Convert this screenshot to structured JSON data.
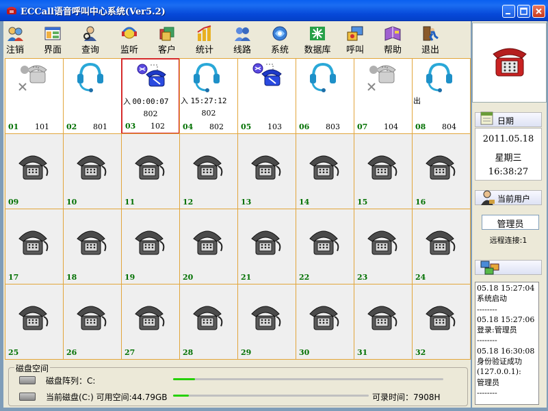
{
  "window": {
    "title": "ECCall语音呼叫中心系统(Ver5.2)",
    "controls": [
      "minimize-icon",
      "maximize-icon",
      "close-icon"
    ]
  },
  "toolbar": [
    {
      "label": "注销",
      "icon": "logout-users-icon"
    },
    {
      "label": "界面",
      "icon": "layout-icon"
    },
    {
      "label": "查询",
      "icon": "search-person-icon"
    },
    {
      "label": "监听",
      "icon": "monitor-headset-icon"
    },
    {
      "label": "客户",
      "icon": "customer-icon"
    },
    {
      "label": "统计",
      "icon": "stats-icon"
    },
    {
      "label": "线路",
      "icon": "line-icon"
    },
    {
      "label": "系统",
      "icon": "system-icon"
    },
    {
      "label": "数据库",
      "icon": "database-icon"
    },
    {
      "label": "呼叫",
      "icon": "call-icon"
    },
    {
      "label": "帮助",
      "icon": "help-book-icon"
    },
    {
      "label": "退出",
      "icon": "exit-icon"
    }
  ],
  "channels": [
    {
      "num": "01",
      "ext": "101",
      "state": "offline",
      "dir": "",
      "time": "",
      "caller": ""
    },
    {
      "num": "02",
      "ext": "801",
      "state": "headset",
      "dir": "",
      "time": "",
      "caller": ""
    },
    {
      "num": "03",
      "ext": "102",
      "state": "in-call",
      "dir": "入",
      "time": "00:00:07",
      "caller": "802",
      "selected": true
    },
    {
      "num": "04",
      "ext": "802",
      "state": "headset",
      "dir": "入",
      "time": "15:27:12",
      "caller": "802"
    },
    {
      "num": "05",
      "ext": "103",
      "state": "in-call",
      "dir": "",
      "time": "",
      "caller": ""
    },
    {
      "num": "06",
      "ext": "803",
      "state": "headset",
      "dir": "",
      "time": "",
      "caller": ""
    },
    {
      "num": "07",
      "ext": "104",
      "state": "offline",
      "dir": "",
      "time": "",
      "caller": ""
    },
    {
      "num": "08",
      "ext": "804",
      "state": "headset",
      "dir": "出",
      "time": "",
      "caller": ""
    },
    {
      "num": "09",
      "ext": "",
      "state": "idle"
    },
    {
      "num": "10",
      "ext": "",
      "state": "idle"
    },
    {
      "num": "11",
      "ext": "",
      "state": "idle"
    },
    {
      "num": "12",
      "ext": "",
      "state": "idle"
    },
    {
      "num": "13",
      "ext": "",
      "state": "idle"
    },
    {
      "num": "14",
      "ext": "",
      "state": "idle"
    },
    {
      "num": "15",
      "ext": "",
      "state": "idle"
    },
    {
      "num": "16",
      "ext": "",
      "state": "idle"
    },
    {
      "num": "17",
      "ext": "",
      "state": "idle"
    },
    {
      "num": "18",
      "ext": "",
      "state": "idle"
    },
    {
      "num": "19",
      "ext": "",
      "state": "idle"
    },
    {
      "num": "20",
      "ext": "",
      "state": "idle"
    },
    {
      "num": "21",
      "ext": "",
      "state": "idle"
    },
    {
      "num": "22",
      "ext": "",
      "state": "idle"
    },
    {
      "num": "23",
      "ext": "",
      "state": "idle"
    },
    {
      "num": "24",
      "ext": "",
      "state": "idle"
    },
    {
      "num": "25",
      "ext": "",
      "state": "idle"
    },
    {
      "num": "26",
      "ext": "",
      "state": "idle"
    },
    {
      "num": "27",
      "ext": "",
      "state": "idle"
    },
    {
      "num": "28",
      "ext": "",
      "state": "idle"
    },
    {
      "num": "29",
      "ext": "",
      "state": "idle"
    },
    {
      "num": "30",
      "ext": "",
      "state": "idle"
    },
    {
      "num": "31",
      "ext": "",
      "state": "idle"
    },
    {
      "num": "32",
      "ext": "",
      "state": "idle"
    }
  ],
  "disk": {
    "title": "磁盘空间",
    "array_label": "磁盘阵列：C:",
    "current_label": "当前磁盘(C:) 可用空间:44.79GB",
    "record_time": "可录时间：7908H",
    "array_usage": 0.08,
    "current_usage": 0.08
  },
  "side": {
    "date_label": "日期",
    "date": "2011.05.18",
    "weekday": "星期三",
    "time": "16:38:27",
    "user_label": "当前用户",
    "user": "管理员",
    "remote": "远程连接:1",
    "log": [
      "05.18 15:27:04",
      "系统启动",
      "--------",
      "05.18 15:27:06",
      "登录:管理员",
      "--------",
      "05.18 16:30:08",
      "身份验证成功",
      "(127.0.0.1):",
      "管理员",
      "--------"
    ]
  },
  "colors": {
    "titlebar": "#0a5ff0",
    "cell_border": "#e2a53a",
    "channel_num": "#007000",
    "selected_border": "#d62a2a",
    "progress": "#25d000"
  }
}
